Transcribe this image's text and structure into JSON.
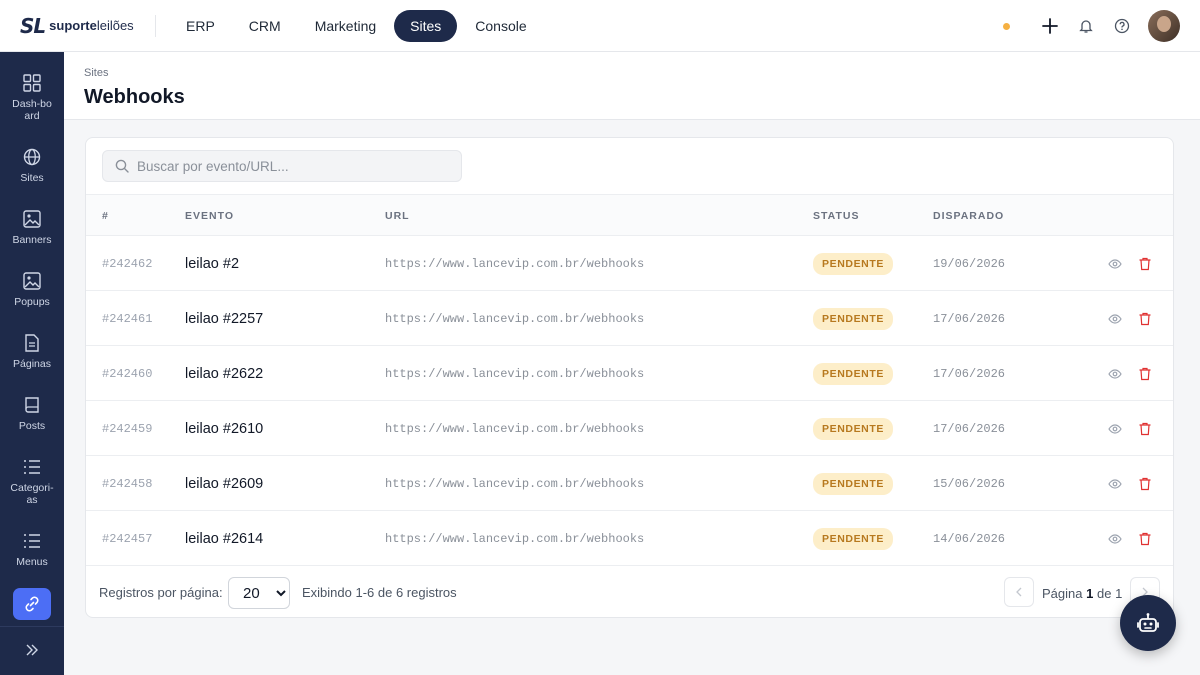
{
  "brand": {
    "mark": "SL",
    "name_bold": "suporte",
    "name_rest": "leilões"
  },
  "top_nav": [
    {
      "label": "ERP",
      "active": false
    },
    {
      "label": "CRM",
      "active": false
    },
    {
      "label": "Marketing",
      "active": false
    },
    {
      "label": "Sites",
      "active": true
    },
    {
      "label": "Console",
      "active": false
    }
  ],
  "sidebar": {
    "items": [
      {
        "label": "Dash-board",
        "icon": "dashboard-icon"
      },
      {
        "label": "Sites",
        "icon": "globe-icon"
      },
      {
        "label": "Banners",
        "icon": "image-icon"
      },
      {
        "label": "Popups",
        "icon": "image-icon"
      },
      {
        "label": "Páginas",
        "icon": "document-icon"
      },
      {
        "label": "Posts",
        "icon": "book-icon"
      },
      {
        "label": "Categori-as",
        "icon": "list-icon"
      },
      {
        "label": "Menus",
        "icon": "list-icon"
      }
    ],
    "active_icon": "link-icon"
  },
  "page": {
    "breadcrumb": "Sites",
    "title": "Webhooks"
  },
  "search": {
    "placeholder": "Buscar por evento/URL..."
  },
  "table": {
    "headers": {
      "id": "#",
      "event": "EVENTO",
      "url": "URL",
      "status": "STATUS",
      "fired": "DISPARADO"
    },
    "rows": [
      {
        "id": "#242462",
        "event": "leilao #2",
        "url": "https://www.lancevip.com.br/webhooks",
        "status": "PENDENTE",
        "date": "19/06/2026"
      },
      {
        "id": "#242461",
        "event": "leilao #2257",
        "url": "https://www.lancevip.com.br/webhooks",
        "status": "PENDENTE",
        "date": "17/06/2026"
      },
      {
        "id": "#242460",
        "event": "leilao #2622",
        "url": "https://www.lancevip.com.br/webhooks",
        "status": "PENDENTE",
        "date": "17/06/2026"
      },
      {
        "id": "#242459",
        "event": "leilao #2610",
        "url": "https://www.lancevip.com.br/webhooks",
        "status": "PENDENTE",
        "date": "17/06/2026"
      },
      {
        "id": "#242458",
        "event": "leilao #2609",
        "url": "https://www.lancevip.com.br/webhooks",
        "status": "PENDENTE",
        "date": "15/06/2026"
      },
      {
        "id": "#242457",
        "event": "leilao #2614",
        "url": "https://www.lancevip.com.br/webhooks",
        "status": "PENDENTE",
        "date": "14/06/2026"
      }
    ]
  },
  "footer": {
    "per_page_label": "Registros por página:",
    "per_page_value": "20",
    "info": "Exibindo 1-6 de 6 registros",
    "page_prefix": "Página",
    "page_current": "1",
    "page_of": "de",
    "page_total": "1"
  },
  "colors": {
    "navy": "#1e2a4a",
    "accent": "#4c6ef5",
    "badge_bg": "#fdeec9",
    "badge_text": "#b7791f",
    "danger": "#e03131",
    "notif_dot": "#f5b042"
  }
}
